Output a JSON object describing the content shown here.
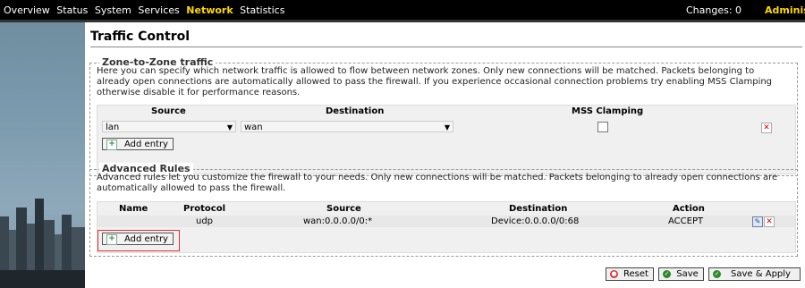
{
  "nav": {
    "items": [
      "Overview",
      "Status",
      "System",
      "Services",
      "Network",
      "Statistics"
    ],
    "active": "Network",
    "changes": "Changes: 0",
    "admin": "Administ"
  },
  "page": {
    "title": "Traffic Control"
  },
  "zone": {
    "legend": "Zone-to-Zone traffic",
    "description": "Here you can specify which network traffic is allowed to flow between network zones. Only new connections will be matched. Packets belonging to already open connections are automatically allowed to pass the firewall. If you experience occasional connection problems try enabling MSS Clamping otherwise disable it for performance reasons.",
    "headers": {
      "source": "Source",
      "destination": "Destination",
      "mss": "MSS Clamping"
    },
    "row": {
      "source": "lan",
      "destination": "wan",
      "mss_checked": false
    },
    "add_label": "Add entry"
  },
  "advanced": {
    "legend": "Advanced Rules",
    "description": "Advanced rules let you customize the firewall to your needs. Only new connections will be matched. Packets belonging to already open connections are automatically allowed to pass the firewall.",
    "headers": {
      "name": "Name",
      "protocol": "Protocol",
      "source": "Source",
      "destination": "Destination",
      "action": "Action"
    },
    "row": {
      "name": "",
      "protocol": "udp",
      "source": "wan:0.0.0.0/0:*",
      "destination": "Device:0.0.0.0/0:68",
      "action": "ACCEPT"
    },
    "add_label": "Add entry"
  },
  "buttons": {
    "reset": "Reset",
    "save": "Save",
    "save_apply": "Save & Apply"
  },
  "colors": {
    "active_nav": "#ffd700",
    "highlight": "#dd3333"
  }
}
